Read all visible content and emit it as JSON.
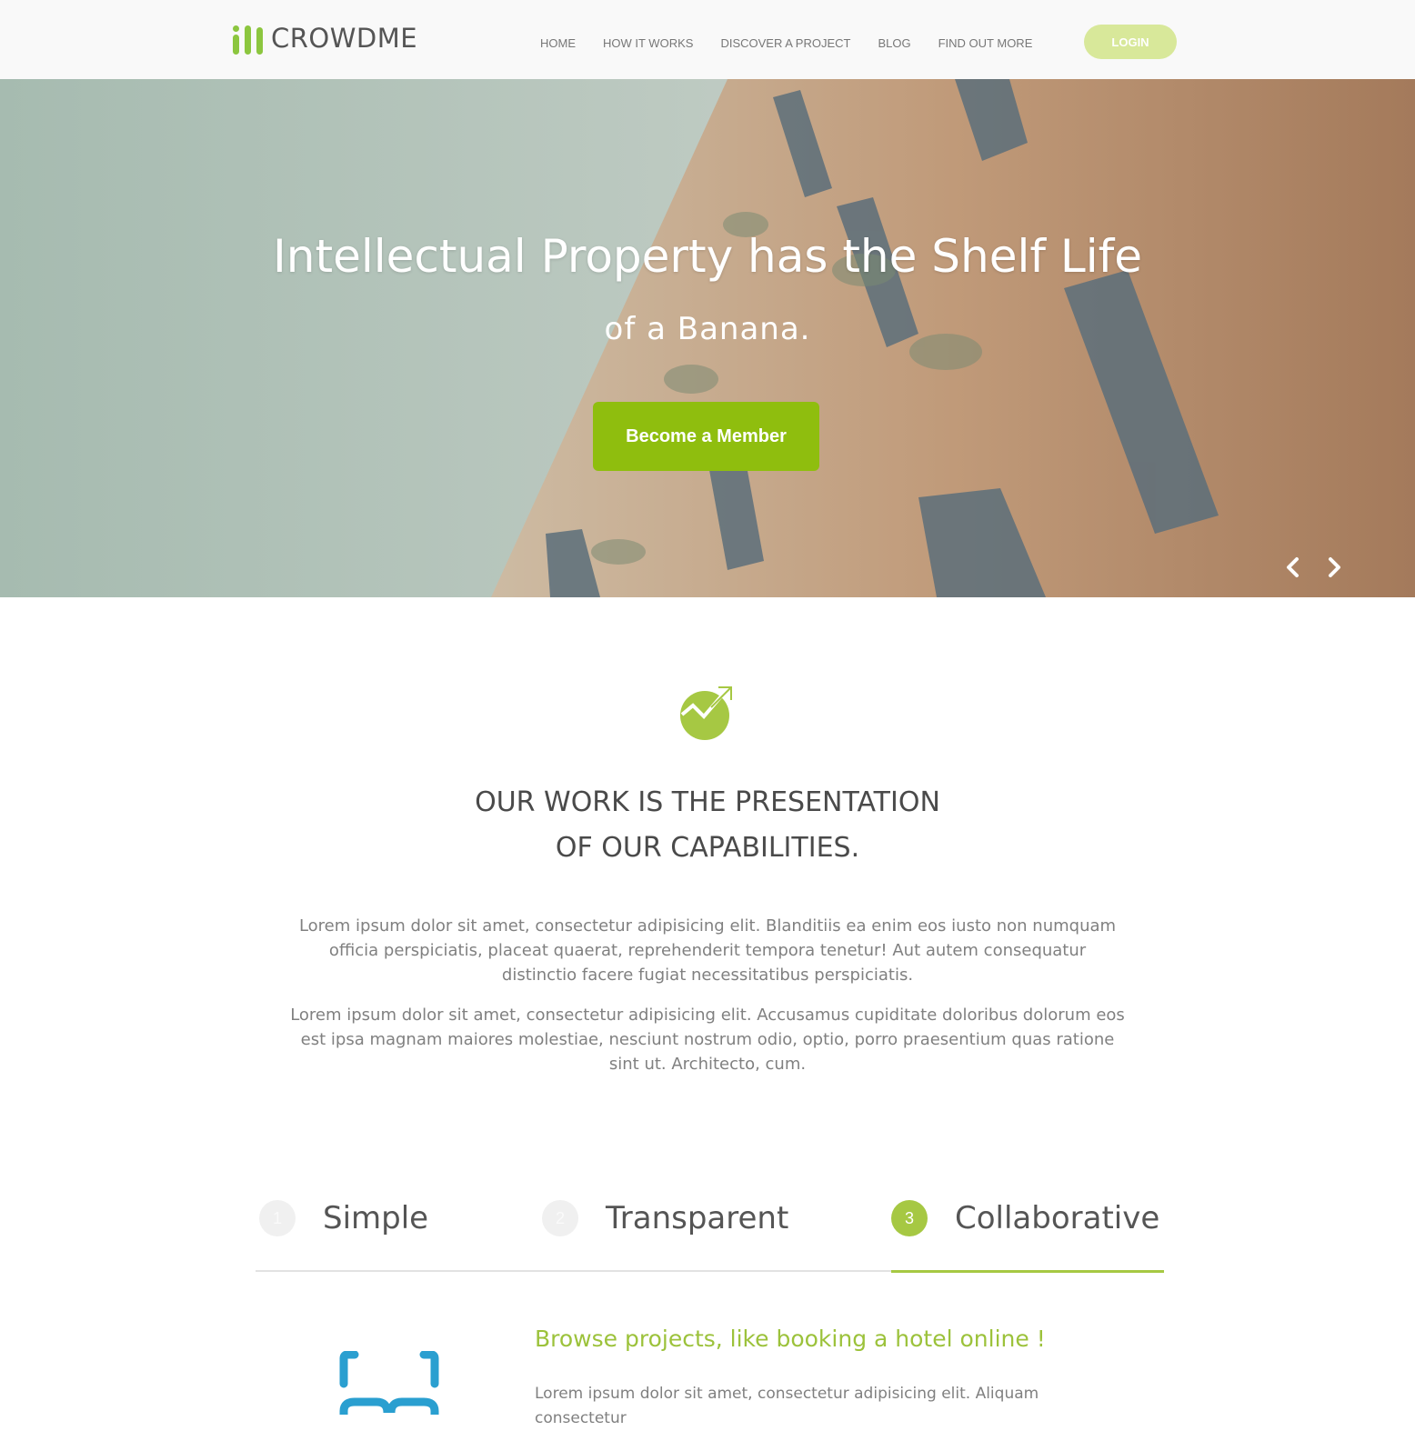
{
  "header": {
    "logo_text": "CROWDME",
    "nav": [
      "HOME",
      "HOW IT WORKS",
      "DISCOVER A PROJECT",
      "BLOG",
      "FIND OUT MORE"
    ],
    "login_label": "LOGIN"
  },
  "hero": {
    "title": "Intellectual Property has the Shelf Life",
    "subtitle": "of a Banana.",
    "cta_label": "Become a Member",
    "prev_icon": "chevron-left-icon",
    "next_icon": "chevron-right-icon"
  },
  "intro": {
    "icon": "growth-chart-icon",
    "title_line1": "OUR WORK IS THE PRESENTATION",
    "title_line2": "OF OUR CAPABILITIES.",
    "paragraph1": "Lorem ipsum dolor sit amet, consectetur adipisicing elit. Blanditiis ea enim eos iusto non numquam officia perspiciatis, placeat quaerat, reprehenderit tempora tenetur! Aut autem consequatur distinctio facere fugiat necessitatibus perspiciatis.",
    "paragraph2": "Lorem ipsum dolor sit amet, consectetur adipisicing elit. Accusamus cupiditate doloribus dolorum eos est ipsa magnam maiores molestiae, nesciunt nostrum odio, optio, porro praesentium quas ratione sint ut. Architecto, cum."
  },
  "tabs": [
    {
      "num": "1",
      "label": "Simple",
      "active": false
    },
    {
      "num": "2",
      "label": "Transparent",
      "active": false
    },
    {
      "num": "3",
      "label": "Collaborative",
      "active": true
    }
  ],
  "tab_content": {
    "icon": "binoculars-icon",
    "title": "Browse projects, like booking a hotel online !",
    "paragraph": "Lorem ipsum dolor sit amet, consectetur adipisicing elit. Aliquam consectetur"
  },
  "colors": {
    "brand_green": "#8cc63f",
    "cta_green": "#8fbe0e",
    "login_bg": "#d8e89a",
    "accent_title": "#9cc23b",
    "icon_blue": "#2a9fd0"
  }
}
